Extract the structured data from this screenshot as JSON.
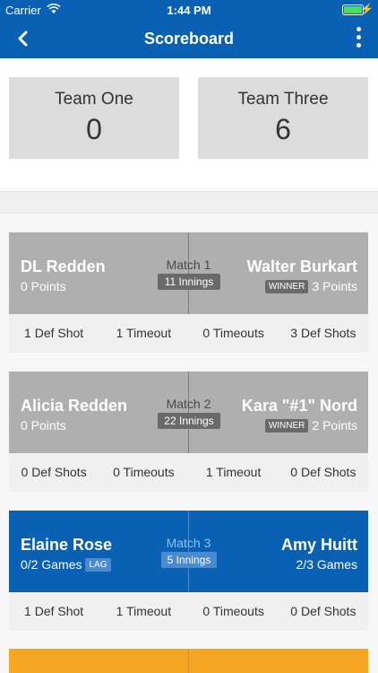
{
  "status_bar": {
    "carrier": "Carrier",
    "time": "1:44 PM"
  },
  "nav": {
    "title": "Scoreboard"
  },
  "teams": [
    {
      "name": "Team One",
      "score": "0"
    },
    {
      "name": "Team Three",
      "score": "6"
    }
  ],
  "matches": [
    {
      "label": "Match 1",
      "innings": "11 Innings",
      "left": {
        "name": "DL Redden",
        "points": "0 Points"
      },
      "right": {
        "name": "Walter Burkart",
        "badge": "WINNER",
        "points": "3 Points"
      },
      "stats": [
        "1 Def Shot",
        "1 Timeout",
        "0 Timeouts",
        "3 Def Shots"
      ]
    },
    {
      "label": "Match 2",
      "innings": "22 Innings",
      "left": {
        "name": "Alicia Redden",
        "points": "0 Points"
      },
      "right": {
        "name": "Kara \"#1\" Nord",
        "badge": "WINNER",
        "points": "2 Points"
      },
      "stats": [
        "0 Def Shots",
        "0 Timeouts",
        "1 Timeout",
        "0 Def Shots"
      ]
    },
    {
      "label": "Match 3",
      "innings": "5 Innings",
      "left": {
        "name": "Elaine Rose",
        "games": "0/2 Games",
        "badge": "LAG"
      },
      "right": {
        "name": "Amy Huitt",
        "games": "2/3 Games"
      },
      "stats": [
        "1 Def Shot",
        "1 Timeout",
        "0 Timeouts",
        "0 Def Shots"
      ]
    }
  ],
  "colors": {
    "primary": "#0a60b3",
    "gray_card": "#afafaf",
    "orange": "#f5a623",
    "battery": "#4cd964"
  }
}
